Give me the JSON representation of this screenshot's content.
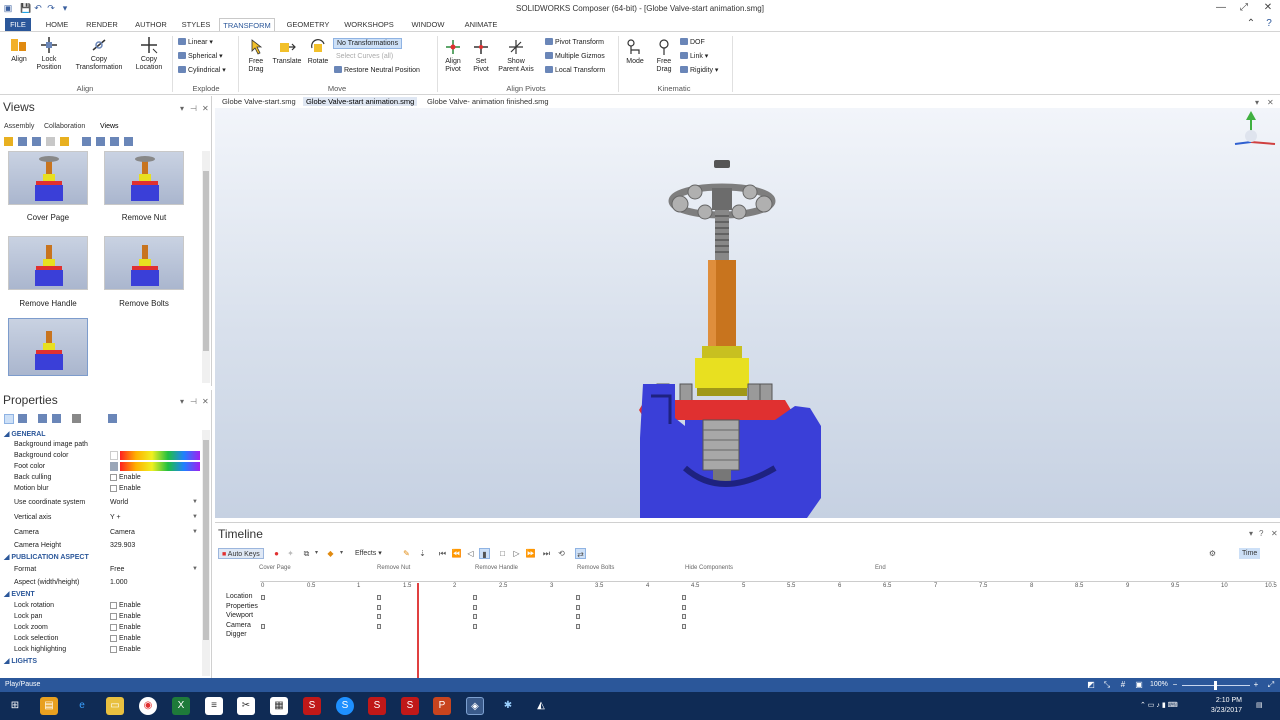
{
  "window": {
    "title": "SOLIDWORKS Composer (64-bit) - [Globe Valve-start animation.smg]",
    "controls": [
      "—",
      "⤢",
      "✕"
    ]
  },
  "ribbon_tabs": [
    "FILE",
    "HOME",
    "RENDER",
    "AUTHOR",
    "STYLES",
    "TRANSFORM",
    "GEOMETRY",
    "WORKSHOPS",
    "WINDOW",
    "ANIMATE"
  ],
  "ribbon": {
    "align": {
      "label": "Align",
      "buttons": [
        "Align",
        "Lock Position",
        "Copy Transformation",
        "Copy Location"
      ]
    },
    "explode": {
      "label": "Explode",
      "items": [
        "Linear",
        "Spherical",
        "Cylindrical"
      ]
    },
    "move": {
      "label": "Move",
      "buttons": [
        "Free Drag",
        "Translate",
        "Rotate"
      ],
      "items": [
        "No Transformations",
        "Select Curves (all)",
        "Restore Neutral Position"
      ]
    },
    "align_pivots": {
      "label": "Align Pivots",
      "buttons": [
        "Align Pivot",
        "Set Pivot",
        "Show Parent Axis"
      ],
      "items": [
        "Pivot Transform",
        "Multiple Gizmos",
        "Local Transform"
      ]
    },
    "kinematic": {
      "label": "Kinematic",
      "buttons": [
        "Mode",
        "Free Drag"
      ],
      "items": [
        "DOF",
        "Link",
        "Rigidity"
      ]
    }
  },
  "views_panel": {
    "title": "Views",
    "subtabs": [
      "Assembly",
      "Collaboration",
      "Views"
    ],
    "thumbnails": [
      "Cover Page",
      "Remove Nut",
      "Remove Handle",
      "Remove Bolts",
      ""
    ]
  },
  "properties_panel": {
    "title": "Properties",
    "sections": {
      "general": "GENERAL",
      "publication": "PUBLICATION ASPECT",
      "event": "EVENT",
      "lights": "LIGHTS"
    },
    "general_rows": [
      {
        "name": "Background image path",
        "value": ""
      },
      {
        "name": "Background color",
        "value": ""
      },
      {
        "name": "Foot color",
        "value": ""
      },
      {
        "name": "Back culling",
        "value": "Enable"
      },
      {
        "name": "Motion blur",
        "value": "Enable"
      },
      {
        "name": "Use coordinate system",
        "value": "World"
      },
      {
        "name": "Vertical axis",
        "value": "Y +"
      },
      {
        "name": "Camera",
        "value": "Camera"
      },
      {
        "name": "Camera Height",
        "value": "329.903"
      }
    ],
    "publication_rows": [
      {
        "name": "Format",
        "value": "Free"
      },
      {
        "name": "Aspect (width/height)",
        "value": "1.000"
      }
    ],
    "event_rows": [
      {
        "name": "Lock rotation",
        "value": "Enable"
      },
      {
        "name": "Lock pan",
        "value": "Enable"
      },
      {
        "name": "Lock zoom",
        "value": "Enable"
      },
      {
        "name": "Lock selection",
        "value": "Enable"
      },
      {
        "name": "Lock highlighting",
        "value": "Enable"
      }
    ]
  },
  "doc_tabs": [
    "Globe Valve-start.smg",
    "Globe Valve-start animation.smg",
    "Globe Valve- animation finished.smg"
  ],
  "timeline": {
    "title": "Timeline",
    "auto_keys": "Auto Keys",
    "effects": "Effects",
    "time_label": "Time",
    "markers": [
      "Cover Page",
      "Remove Nut",
      "Remove Handle",
      "Remove Bolts",
      "Hide Components",
      "End"
    ],
    "ticks": [
      "0",
      "0.5",
      "1",
      "1.5",
      "2",
      "2.5",
      "3",
      "3.5",
      "4",
      "4.5",
      "5",
      "5.5",
      "6",
      "6.5",
      "7",
      "7.5",
      "8",
      "8.5",
      "9",
      "9.5",
      "10",
      "10.5"
    ],
    "tracks": [
      "Location",
      "Properties",
      "Viewport",
      "Camera",
      "Digger"
    ]
  },
  "status": {
    "left": "Play/Pause",
    "zoom": "100%"
  },
  "tray": {
    "time": "2:10 PM",
    "date": "3/23/2017"
  },
  "colors": {
    "accent": "#2b579a",
    "valve_body": "#3a3fd8",
    "bonnet": "#e8e020",
    "flange": "#e03030",
    "stem": "#c8741e"
  }
}
